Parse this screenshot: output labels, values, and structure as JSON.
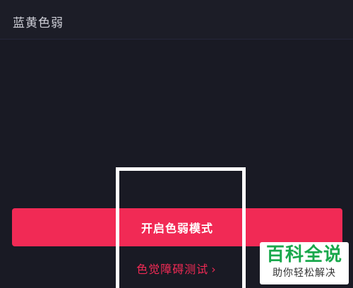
{
  "options": {
    "blue_yellow_label": "蓝黄色弱"
  },
  "actions": {
    "enable_label": "开启色弱模式",
    "test_label": "色觉障碍测试"
  },
  "icons": {
    "chevron": "›"
  },
  "watermark": {
    "title": "百科全说",
    "subtitle": "助你轻松解决"
  },
  "colors": {
    "background": "#191a24",
    "accent": "#f12a55",
    "watermark_green": "#1aa84c"
  }
}
